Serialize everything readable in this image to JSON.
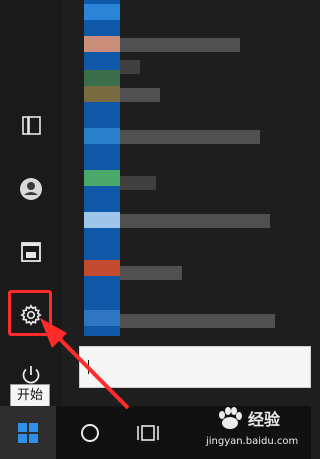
{
  "start_menu": {
    "rail": {
      "items": [
        {
          "icon": "documents-icon"
        },
        {
          "icon": "user-account-icon"
        },
        {
          "icon": "pictures-icon"
        },
        {
          "icon": "settings-gear-icon"
        },
        {
          "icon": "power-icon"
        }
      ],
      "tooltip": "开始"
    }
  },
  "taskbar": {
    "start_icon": "windows-logo-icon",
    "items": [
      {
        "icon": "cortana-circle-icon"
      },
      {
        "icon": "task-view-icon"
      }
    ]
  },
  "watermark": {
    "brand_text": "经验",
    "url_text": "jingyan.baidu.com"
  },
  "colors": {
    "highlight_red": "#ff2a2a",
    "menu_bg": "#1e1e1e",
    "tile_blue": "#0f58a8",
    "taskbar_bg": "#111111"
  }
}
